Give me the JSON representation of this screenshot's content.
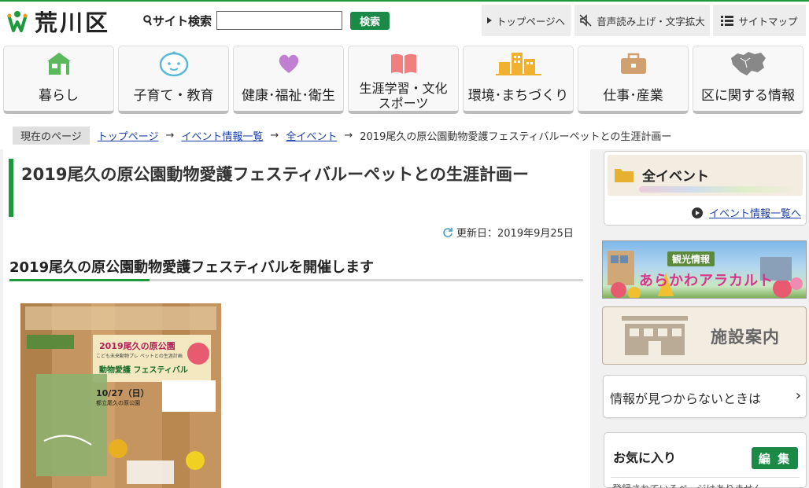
{
  "header": {
    "logo_text": "荒川区",
    "search_label": "サイト検索",
    "search_value": "",
    "search_button": "検索",
    "util_links": [
      "トップページへ",
      "音声読み上げ・文字拡大",
      "サイトマップ"
    ]
  },
  "nav": [
    {
      "label": "暮らし",
      "icon": "house-icon",
      "color": "#5cb85c"
    },
    {
      "label": "子育て・教育",
      "icon": "baby-face-icon",
      "color": "#5bb8d8"
    },
    {
      "label": "健康･福祉･衛生",
      "icon": "heart-icon",
      "color": "#c07fd0"
    },
    {
      "label": "生涯学習・文化スポーツ",
      "label_line1": "生涯学習・文化",
      "label_line2": "スポーツ",
      "icon": "open-book-icon",
      "color": "#f08080"
    },
    {
      "label": "環境･まちづくり",
      "icon": "buildings-icon",
      "color": "#f0b030"
    },
    {
      "label": "仕事･産業",
      "icon": "briefcase-icon",
      "color": "#d0a070"
    },
    {
      "label": "区に関する情報",
      "icon": "ward-map-icon",
      "color": "#888888"
    }
  ],
  "breadcrumb": {
    "here": "現在のページ",
    "links": [
      "トップページ",
      "イベント情報一覧",
      "全イベント"
    ],
    "current": "2019尾久の原公園動物愛護フェスティバルーペットとの生涯計画ー"
  },
  "main": {
    "title": "2019尾久の原公園動物愛護フェスティバルーペットとの生涯計画ー",
    "updated": "更新日：2019年9月25日",
    "heading": "2019尾久の原公園動物愛護フェスティバルを開催します"
  },
  "poster": {
    "title": "2019尾久の原公園",
    "subtitle": "こども未来動物プレ ペットとの生涯計画",
    "festival": "動物愛護 フェスティバル",
    "date": "10/27（日）",
    "place": "都立尾久の原公園"
  },
  "sidebar": {
    "category_title": "全イベント",
    "category_link": "イベント情報一覧へ",
    "banner_tag": "観光情報",
    "banner_name": "あらかわアラカルト",
    "facility": "施設案内",
    "not_found": "情報が見つからないときは",
    "favorites_title": "お気に入り",
    "favorites_edit": "編 集",
    "favorites_empty": "登録されているページはありません"
  },
  "colors": {
    "brand_green": "#1e9a3c",
    "button_green": "#1a8a46",
    "link": "#1a3faa"
  }
}
